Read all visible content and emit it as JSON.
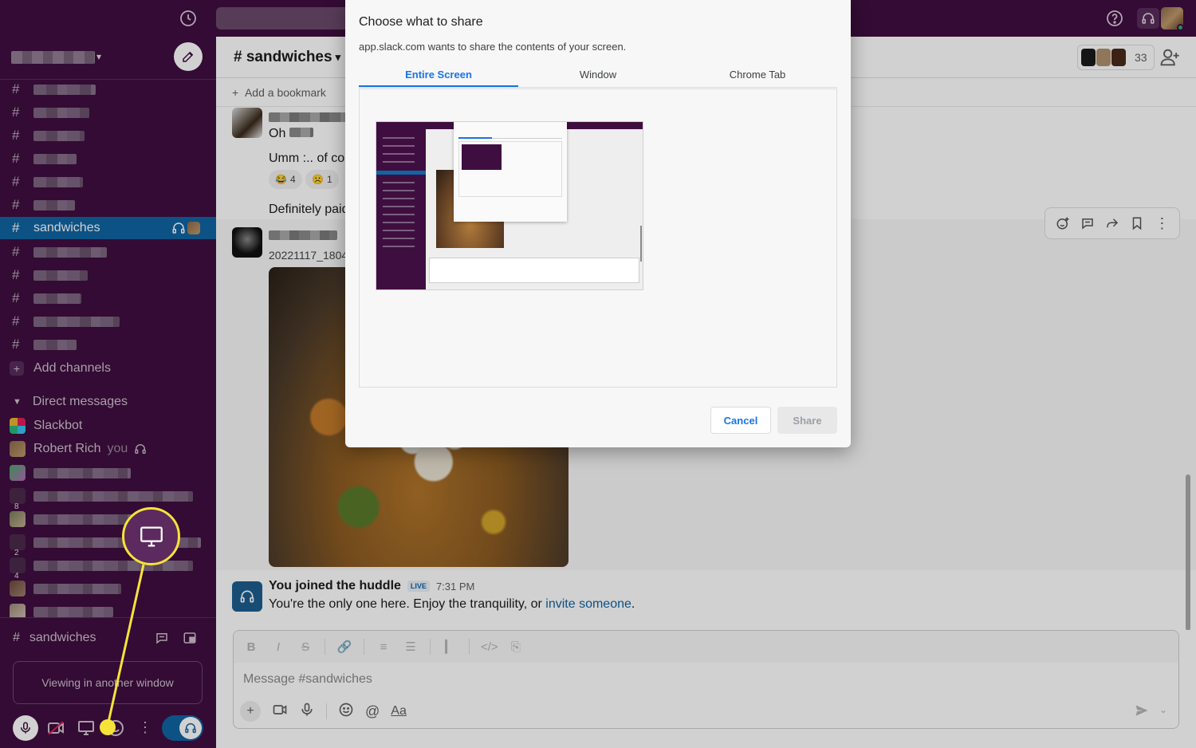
{
  "sidebar": {
    "active_channel": "sandwiches",
    "add_channels": "Add channels",
    "direct_messages": "Direct messages",
    "dms": [
      {
        "name": "Slackbot"
      },
      {
        "name": "Robert Rich",
        "tag": "you"
      }
    ],
    "dm_counts": [
      "8",
      "2",
      "4"
    ],
    "huddle": {
      "channel": "sandwiches",
      "viewing": "Viewing in another window"
    }
  },
  "header": {
    "channel_title": "# sandwiches",
    "member_count": "33",
    "add_bookmark": "Add a bookmark"
  },
  "messages": {
    "m1_text": "Oh",
    "m2_text": "Umm :.. of cou",
    "reactions": [
      {
        "emoji": "😂",
        "count": "4"
      },
      {
        "emoji": "☹️",
        "count": "1"
      }
    ],
    "m3_text": "Definitely paid",
    "m4_text": "20221117_1804",
    "huddle_title": "You joined the huddle",
    "live": "LIVE",
    "time": "7:31 PM",
    "huddle_body": "You're the only one here. Enjoy the tranquility, or ",
    "invite_link": "invite someone",
    "huddle_end": "."
  },
  "composer": {
    "placeholder": "Message #sandwiches",
    "aa": "Aa"
  },
  "dialog": {
    "title": "Choose what to share",
    "subtitle": "app.slack.com wants to share the contents of your screen.",
    "tabs": [
      "Entire Screen",
      "Window",
      "Chrome Tab"
    ],
    "active_tab": "Entire Screen",
    "cancel": "Cancel",
    "share": "Share"
  },
  "colors": {
    "sidebar": "#3f0e40",
    "active": "#1164a3",
    "callout": "#f5e33a",
    "link": "#1a73e8"
  }
}
